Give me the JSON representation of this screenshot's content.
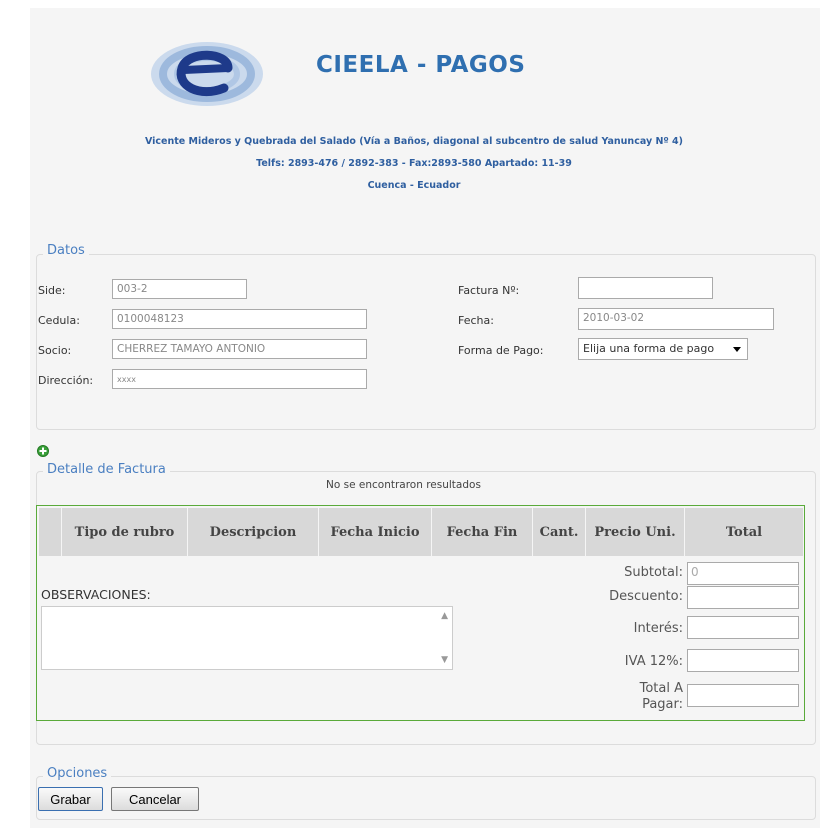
{
  "header": {
    "title": "CIEELA - PAGOS",
    "address_line1": "Vicente Mideros y Quebrada del Salado (Vía a Baños, diagonal al subcentro de salud Yanuncay Nº 4)",
    "address_line2": "Telfs: 2893-476 / 2892-383 - Fax:2893-580 Apartado: 11-39",
    "address_line3": "Cuenca - Ecuador"
  },
  "datos": {
    "legend": "Datos",
    "side_label": "Side:",
    "side_value": "003-2",
    "cedula_label": "Cedula:",
    "cedula_value": "0100048123",
    "socio_label": "Socio:",
    "socio_value": "CHERREZ TAMAYO ANTONIO",
    "direccion_label": "Dirección:",
    "direccion_value": "xxxx",
    "factura_label": "Factura Nº:",
    "factura_value": "",
    "fecha_label": "Fecha:",
    "fecha_value": "2010-03-02",
    "forma_pago_label": "Forma de Pago:",
    "forma_pago_value": "Elija una forma de pago"
  },
  "detalle": {
    "legend": "Detalle de Factura",
    "empty_message": "No se encontraron resultados",
    "columns": [
      "Tipo de rubro",
      "Descripcion",
      "Fecha Inicio",
      "Fecha Fin",
      "Cant.",
      "Precio Uni.",
      "Total"
    ],
    "observaciones_label": "OBSERVACIONES:",
    "subtotal_label": "Subtotal:",
    "subtotal_value": "0",
    "descuento_label": "Descuento:",
    "interes_label": "Interés:",
    "iva_label": "IVA 12%:",
    "total_label_1": "Total A",
    "total_label_2": "Pagar:"
  },
  "opciones": {
    "legend": "Opciones",
    "grabar_label": "Grabar",
    "cancelar_label": "Cancelar"
  },
  "colors": {
    "accent": "#2f6fb0",
    "legend": "#4a7fc1",
    "grid_border": "#5aaa3a",
    "header_bg": "#d8d8d8"
  }
}
